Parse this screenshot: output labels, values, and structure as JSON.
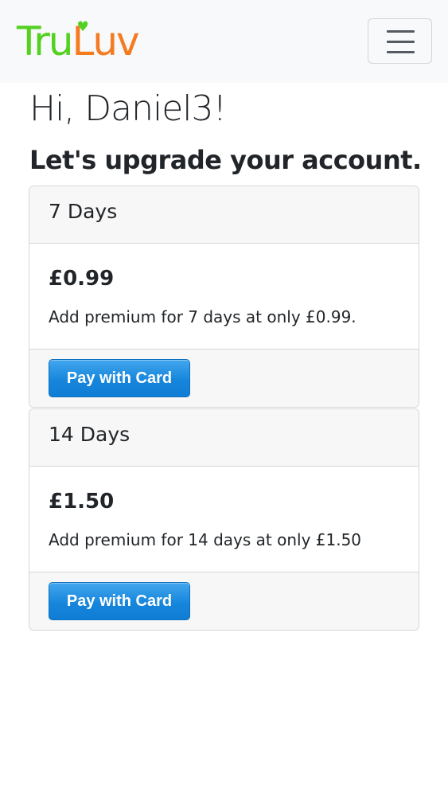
{
  "brand": {
    "logo_parts": [
      "Tru",
      "L",
      "uv"
    ],
    "logo_text": "TruLuv",
    "colors": {
      "green": "#52d11f",
      "orange": "#f47b20"
    }
  },
  "nav": {
    "toggle_icon": "hamburger-menu-icon"
  },
  "greeting": "Hi, Daniel3!",
  "subheading": "Let's upgrade your account.",
  "plans": [
    {
      "title": "7 Days",
      "price": "£0.99",
      "description": "Add premium for 7 days at only £0.99.",
      "button_label": "Pay with Card"
    },
    {
      "title": "14 Days",
      "price": "£1.50",
      "description": "Add premium for 14 days at only £1.50",
      "button_label": "Pay with Card"
    }
  ],
  "theme": {
    "accent_button": "#1686dc",
    "card_header_bg": "#f7f7f7",
    "navbar_bg": "#f8f9fa"
  }
}
